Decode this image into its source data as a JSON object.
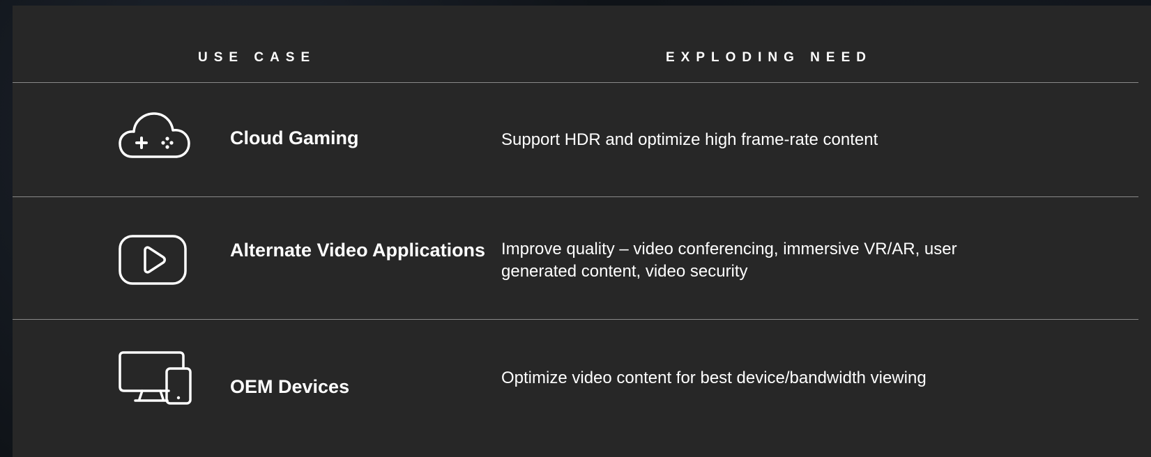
{
  "table": {
    "headers": {
      "use_case": "USE CASE",
      "exploding_need": "EXPLODING NEED"
    },
    "rows": [
      {
        "icon": "cloud-gaming-icon",
        "use_case": "Cloud Gaming",
        "need": "Support HDR and optimize high frame-rate content"
      },
      {
        "icon": "play-video-icon",
        "use_case": "Alternate Video Applications",
        "need": "Improve quality – video conferencing, immersive VR/AR, user generated content, video security"
      },
      {
        "icon": "monitor-tablet-icon",
        "use_case": "OEM Devices",
        "need": "Optimize video content for best device/bandwidth viewing"
      }
    ]
  }
}
